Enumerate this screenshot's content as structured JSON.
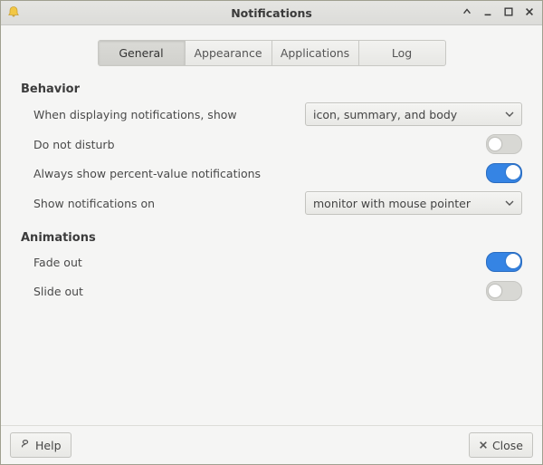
{
  "window": {
    "title": "Notifications"
  },
  "tabs": {
    "general": "General",
    "appearance": "Appearance",
    "applications": "Applications",
    "log": "Log"
  },
  "sections": {
    "behavior": {
      "title": "Behavior",
      "display_label": "When displaying notifications, show",
      "display_value": "icon, summary, and body",
      "dnd_label": "Do not disturb",
      "dnd_on": false,
      "percent_label": "Always show percent-value notifications",
      "percent_on": true,
      "show_on_label": "Show notifications on",
      "show_on_value": "monitor with mouse pointer"
    },
    "animations": {
      "title": "Animations",
      "fade_label": "Fade out",
      "fade_on": true,
      "slide_label": "Slide out",
      "slide_on": false
    }
  },
  "buttons": {
    "help": "Help",
    "close": "Close"
  }
}
